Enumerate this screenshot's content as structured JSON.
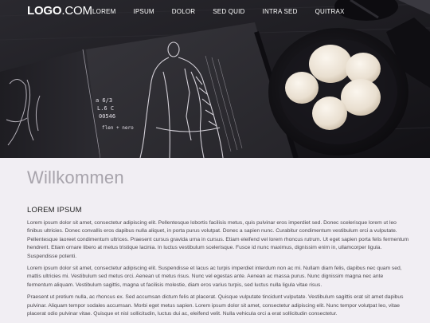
{
  "header": {
    "logo_prefix": "LOGO",
    "logo_suffix": ".COM",
    "nav": [
      {
        "label": "LOREM"
      },
      {
        "label": "IPSUM"
      },
      {
        "label": "DOLOR"
      },
      {
        "label": "SED QUID"
      },
      {
        "label": "INTRA SED"
      },
      {
        "label": "QUITRAX"
      }
    ]
  },
  "hero": {
    "sketch_notes": [
      "a 6/3",
      "L.6 C",
      "00546",
      "flen + nero"
    ]
  },
  "main": {
    "title": "Willkommen",
    "heading": "LOREM IPSUM",
    "paragraphs": [
      "Lorem ipsum dolor sit amet, consectetur adipiscing elit. Pellentesque lobortis facilisis metus, quis pulvinar eros imperdiet sed. Donec scelerisque lorem ut leo finibus ultricies. Donec convallis eros dapibus nulla aliquet, in porta purus volutpat. Donec a sapien nunc. Curabitur condimentum vestibulum orci a vulputate. Pellentesque laoreet condimentum ultrices. Praesent cursus gravida urna in cursus. Etiam eleifend vel lorem rhoncus rutrum. Ut eget sapien porta felis fermentum hendrerit. Etiam ornare libero at metus tristique lacinia. In luctus vestibulum scelerisque. Fusce id nunc maximus, dignissim enim in, ullamcorper ligula. Suspendisse potenti.",
      "Lorem ipsum dolor sit amet, consectetur adipiscing elit. Suspendisse et lacus ac turpis imperdiet interdum non ac mi. Nullam diam felis, dapibus nec quam sed, mattis ultricies mi. Vestibulum sed metus orci. Aenean ut metus risus. Nunc vel egestas ante. Aenean ac massa purus. Nunc dignissim magna nec ante fermentum aliquam. Vestibulum sagittis, magna ut facilisis molestie, diam eros varius turpis, sed luctus nulla ligula vitae risus.",
      "Praesent ut pretium nulla, ac rhoncus ex. Sed accumsan dictum felis at placerat. Quisque vulputate tincidunt vulputate. Vestibulum sagittis erat sit amet dapibus pulvinar. Aliquam tempor sodales accumsan. Morbi eget metus sapien. Lorem ipsum dolor sit amet, consectetur adipiscing elit. Nunc tempor volutpat leo, vitae placerat odio pulvinar vitae. Quisque et nisl sollicitudin, luctus dui ac, eleifend velit. Nulla vehicula orci a erat sollicitudin consectetur."
    ]
  },
  "colors": {
    "hero_bg": "#19181c",
    "page_bg": "#f1eef3",
    "title": "#a7a3ab",
    "body_text": "#4a474d"
  }
}
